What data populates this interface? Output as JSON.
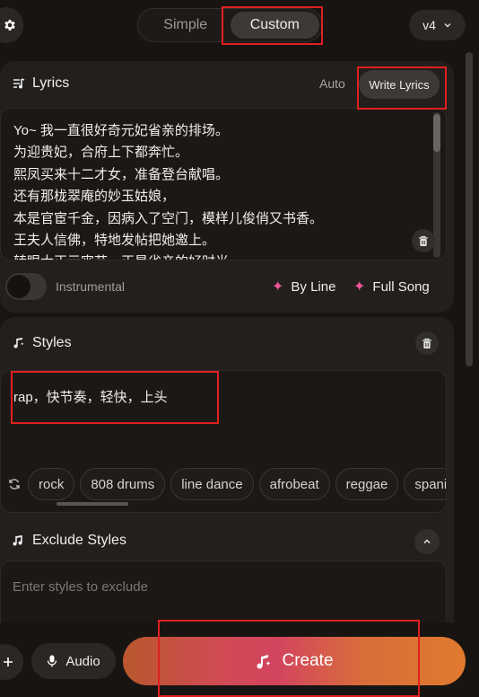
{
  "header": {
    "modes": [
      "Simple",
      "Custom"
    ],
    "active_mode": "Custom",
    "version": "v4"
  },
  "lyrics": {
    "title": "Lyrics",
    "auto_label": "Auto",
    "write_label": "Write Lyrics",
    "text": "Yo~ 我一直很好奇元妃省亲的排场。\n为迎贵妃，合府上下都奔忙。\n熙凤买来十二才女，准备登台献唱。\n还有那栊翠庵的妙玉姑娘，\n本是官宦千金，因病入了空门，模样儿俊俏又书香。\n王夫人信佛，特地发帖把她邀上。\n转眼大正元宵节，正是省亲的好时光"
  },
  "controls": {
    "instrumental_label": "Instrumental",
    "instrumental_on": false,
    "by_line_label": "By Line",
    "full_song_label": "Full Song"
  },
  "styles": {
    "title": "Styles",
    "value": "rap，快节奏，轻快，上头",
    "tags": [
      "rock",
      "808 drums",
      "line dance",
      "afrobeat",
      "reggae",
      "spani"
    ]
  },
  "exclude": {
    "title": "Exclude Styles",
    "placeholder": "Enter styles to exclude"
  },
  "footer": {
    "audio_label": "Audio",
    "create_label": "Create"
  },
  "colors": {
    "accent_pink": "#f0579a",
    "annotation_red": "#e0201f",
    "background": "#171412"
  }
}
